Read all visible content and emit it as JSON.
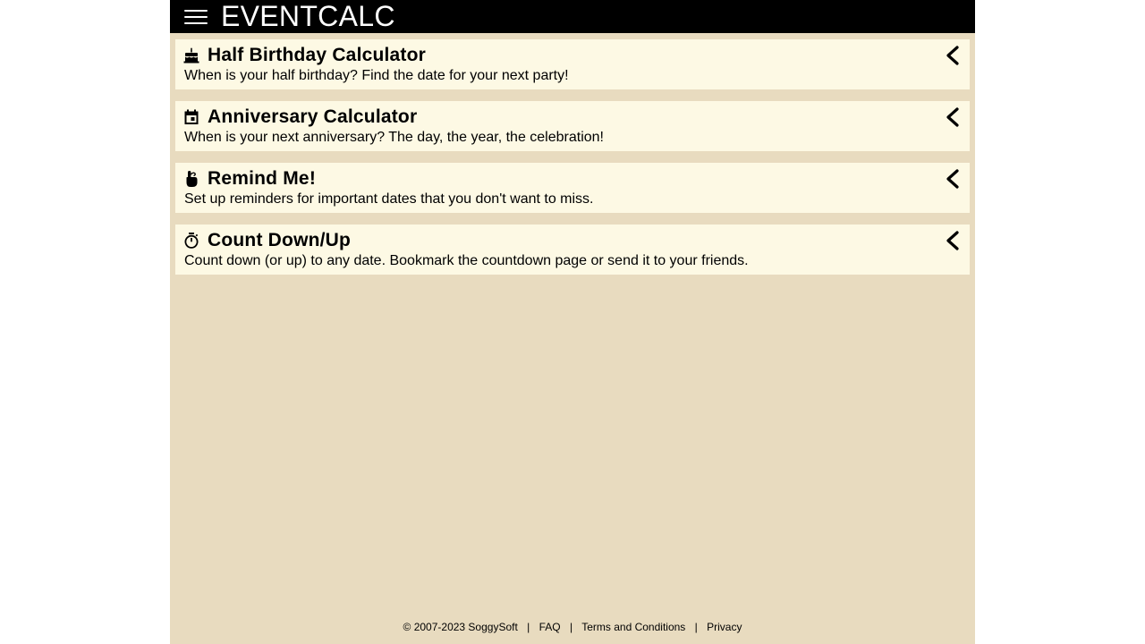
{
  "header": {
    "brand": "EVENTCALC",
    "menu_icon": "hamburger-menu-icon"
  },
  "cards": [
    {
      "icon": "birthday-cake-icon",
      "title": "Half Birthday Calculator",
      "description": "When is your half birthday? Find the date for your next party!"
    },
    {
      "icon": "calendar-event-icon",
      "title": "Anniversary Calculator",
      "description": "When is your next anniversary? The day, the year, the celebration!"
    },
    {
      "icon": "finger-ribbon-icon",
      "title": "Remind Me!",
      "description": "Set up reminders for important dates that you don't want to miss."
    },
    {
      "icon": "stopwatch-icon",
      "title": "Count Down/Up",
      "description": "Count down (or up) to any date. Bookmark the countdown page or send it to your friends."
    }
  ],
  "footer": {
    "copyright": "© 2007-2023 SoggySoft",
    "separator": "|",
    "links": [
      "FAQ",
      "Terms and Conditions",
      "Privacy"
    ]
  },
  "colors": {
    "topbar": "#000000",
    "page_background": "#e8dbbf",
    "card_background": "#fdf9e4",
    "text": "#000000"
  }
}
